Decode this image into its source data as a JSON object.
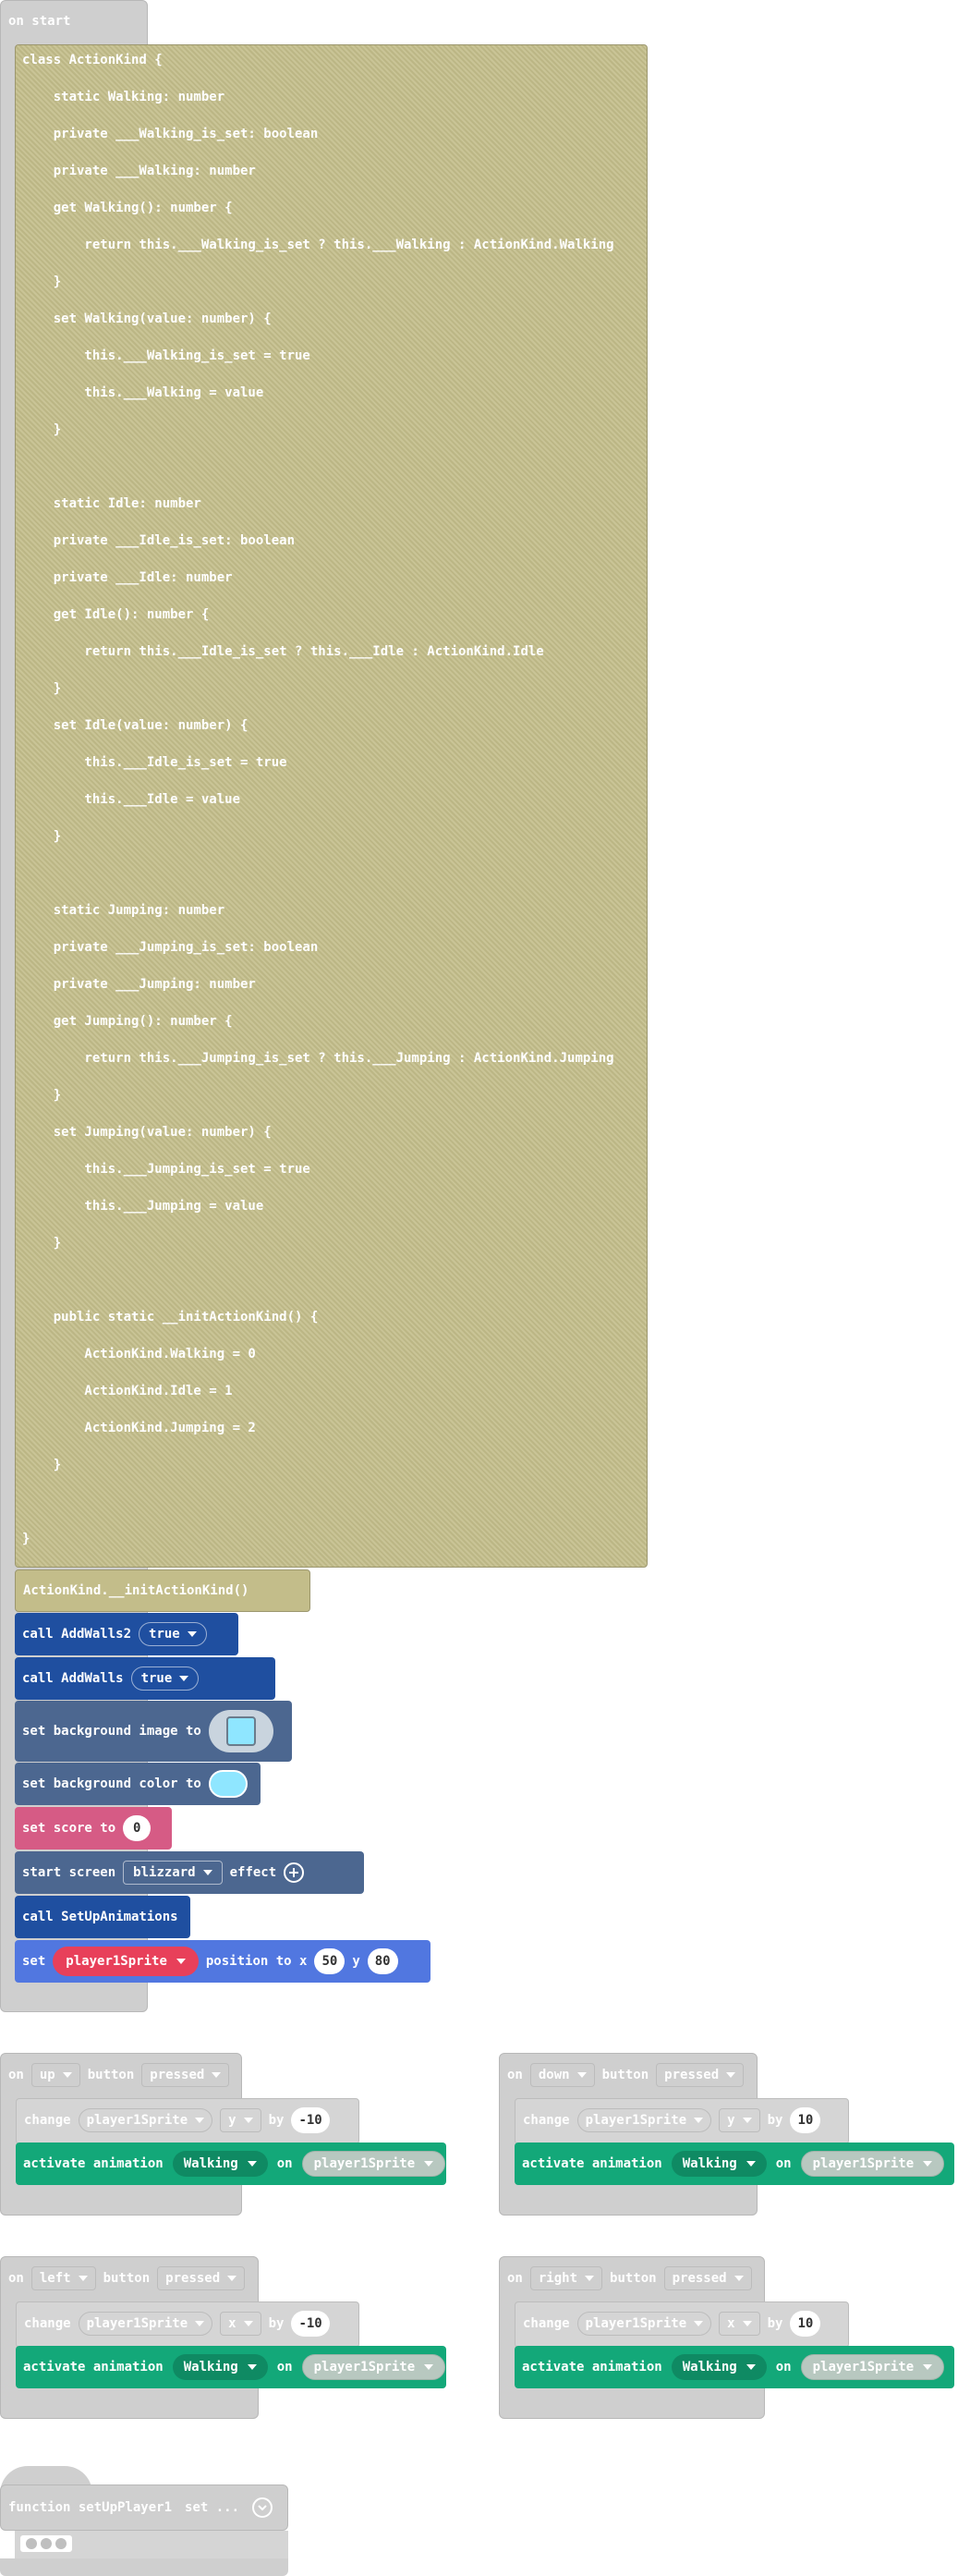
{
  "on_start": {
    "label": "on start",
    "code_lines": [
      "class ActionKind {",
      "    static Walking: number",
      "    private ___Walking_is_set: boolean",
      "    private ___Walking: number",
      "    get Walking(): number {",
      "        return this.___Walking_is_set ? this.___Walking : ActionKind.Walking",
      "    }",
      "    set Walking(value: number) {",
      "        this.___Walking_is_set = true",
      "        this.___Walking = value",
      "    }",
      "",
      "    static Idle: number",
      "    private ___Idle_is_set: boolean",
      "    private ___Idle: number",
      "    get Idle(): number {",
      "        return this.___Idle_is_set ? this.___Idle : ActionKind.Idle",
      "    }",
      "    set Idle(value: number) {",
      "        this.___Idle_is_set = true",
      "        this.___Idle = value",
      "    }",
      "",
      "    static Jumping: number",
      "    private ___Jumping_is_set: boolean",
      "    private ___Jumping: number",
      "    get Jumping(): number {",
      "        return this.___Jumping_is_set ? this.___Jumping : ActionKind.Jumping",
      "    }",
      "    set Jumping(value: number) {",
      "        this.___Jumping_is_set = true",
      "        this.___Jumping = value",
      "    }",
      "",
      "    public static __initActionKind() {",
      "        ActionKind.Walking = 0",
      "        ActionKind.Idle = 1",
      "        ActionKind.Jumping = 2",
      "    }",
      "",
      "}"
    ],
    "init_call": "ActionKind.__initActionKind()",
    "call_addwalls2": {
      "prefix": "call AddWalls2",
      "value": "true"
    },
    "call_addwalls": {
      "prefix": "call AddWalls",
      "value": "true"
    },
    "set_bg_image": "set background image to",
    "set_bg_color": "set background color to",
    "set_score": {
      "prefix": "set score to",
      "value": "0"
    },
    "start_screen": {
      "prefix": "start screen",
      "effect": "blizzard",
      "suffix": "effect"
    },
    "call_setup_animations": "call SetUpAnimations",
    "set_position": {
      "set": "set",
      "sprite": "player1Sprite",
      "position_to_x": "position to x",
      "x": "50",
      "y_label": "y",
      "y": "80"
    }
  },
  "controller_events": [
    {
      "on": "on",
      "button": "up",
      "button_word": "button",
      "event": "pressed",
      "change": "change",
      "sprite": "player1Sprite",
      "axis": "y",
      "by": "by",
      "delta": "-10",
      "activate": "activate animation",
      "animation": "Walking",
      "on2": "on",
      "target": "player1Sprite"
    },
    {
      "on": "on",
      "button": "down",
      "button_word": "button",
      "event": "pressed",
      "change": "change",
      "sprite": "player1Sprite",
      "axis": "y",
      "by": "by",
      "delta": "10",
      "activate": "activate animation",
      "animation": "Walking",
      "on2": "on",
      "target": "player1Sprite"
    },
    {
      "on": "on",
      "button": "left",
      "button_word": "button",
      "event": "pressed",
      "change": "change",
      "sprite": "player1Sprite",
      "axis": "x",
      "by": "by",
      "delta": "-10",
      "activate": "activate animation",
      "animation": "Walking",
      "on2": "on",
      "target": "player1Sprite"
    },
    {
      "on": "on",
      "button": "right",
      "button_word": "button",
      "event": "pressed",
      "change": "change",
      "sprite": "player1Sprite",
      "axis": "x",
      "by": "by",
      "delta": "10",
      "activate": "activate animation",
      "animation": "Walking",
      "on2": "on",
      "target": "player1Sprite"
    }
  ],
  "function_block": {
    "label": "function setUpPlayer1",
    "suffix": "set ..."
  },
  "colors": {
    "hat_gray": "#cfcfcf",
    "code_olive": "#c3bd8a",
    "call_blue": "#1f4fa0",
    "scene_slate": "#4c6790",
    "score_pink": "#d65b85",
    "sprite_blue": "#5177e0",
    "sprite_red": "#e8405a",
    "animation_green": "#13a879",
    "bg_color_swatch": "#8fe6ff"
  },
  "icons": [
    "caret-down-icon",
    "plus-circle-icon",
    "background-image-icon",
    "color-swatch-icon",
    "chevron-circle-icon",
    "dots-icon"
  ]
}
